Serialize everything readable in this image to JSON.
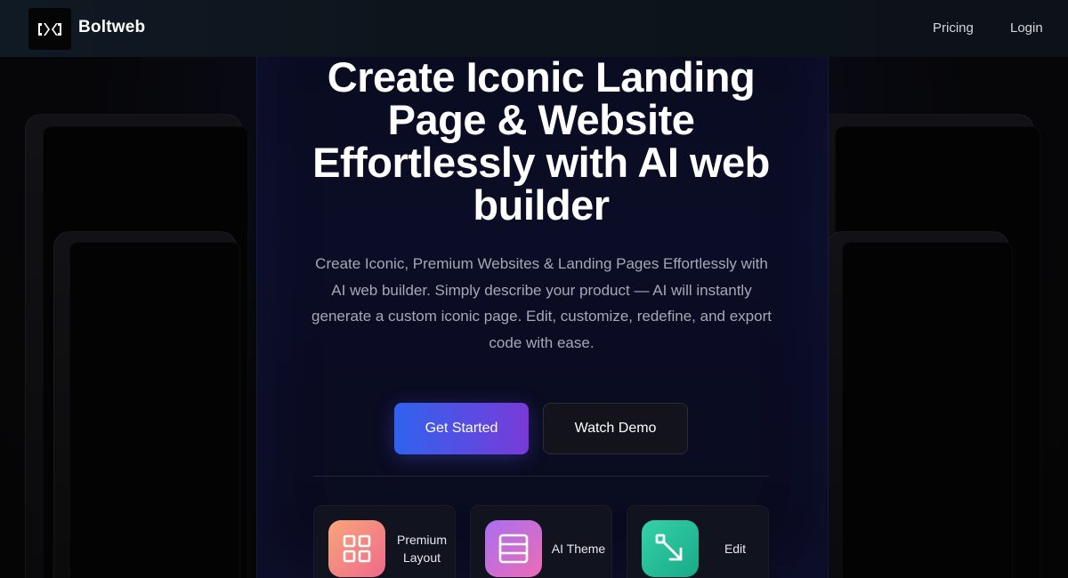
{
  "navbar": {
    "brand": "Boltweb",
    "links": [
      {
        "label": "Pricing"
      },
      {
        "label": "Login"
      }
    ]
  },
  "hero": {
    "title": "Create Iconic Landing Page & Website Effortlessly with AI web builder",
    "subtitle": "Create Iconic, Premium Websites & Landing Pages Effortlessly with AI web builder. Simply describe your product — AI will instantly generate a custom iconic page. Edit, customize, redefine, and export code with ease.",
    "primary_button": "Get Started",
    "secondary_button": "Watch Demo"
  },
  "features": [
    {
      "label": "Premium Layout",
      "icon": "grid-icon",
      "gradient": [
        "#f49a7a",
        "#f06c8a"
      ]
    },
    {
      "label": "AI Theme",
      "icon": "layers-icon",
      "gradient": [
        "#b86ee6",
        "#e66fb8"
      ]
    },
    {
      "label": "Edit",
      "icon": "resize-arrow-icon",
      "gradient": [
        "#2ec9a0",
        "#1fae8c"
      ]
    }
  ],
  "colors": {
    "accent_start": "#2f63ee",
    "accent_end": "#7a3ad8",
    "background": "#070709"
  }
}
